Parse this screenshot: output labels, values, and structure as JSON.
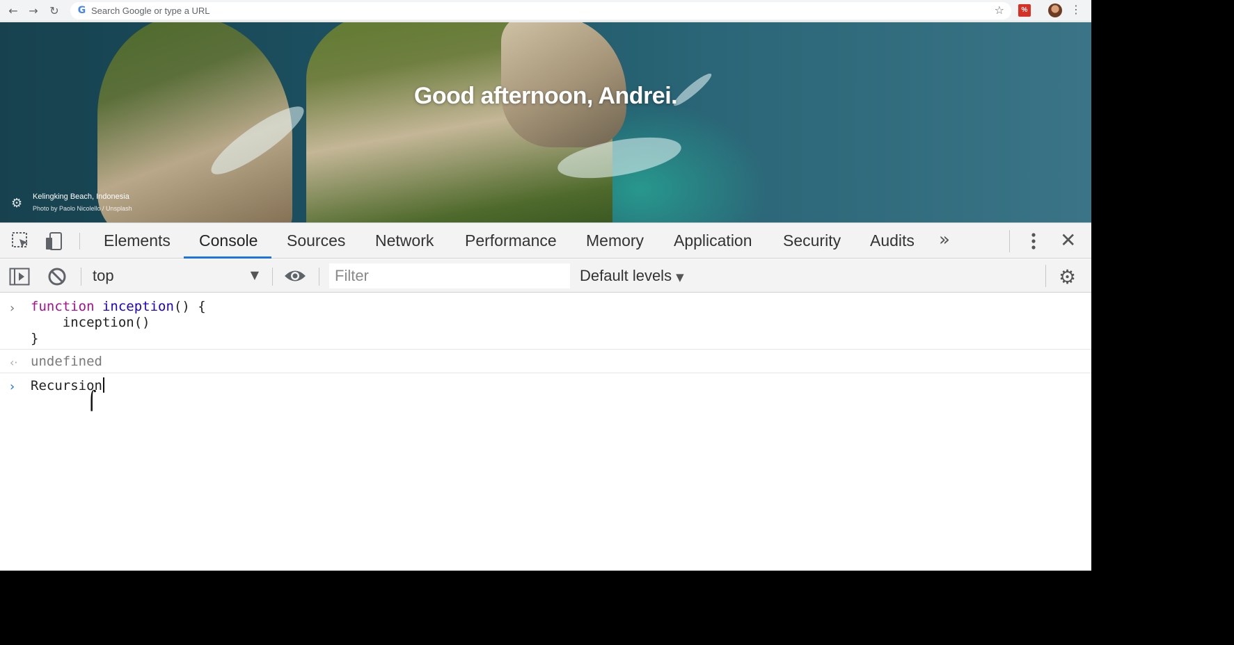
{
  "browser": {
    "back_icon": "back-arrow-icon",
    "forward_icon": "forward-arrow-icon",
    "reload_icon": "reload-icon",
    "omnibox_placeholder": "Search Google or type a URL",
    "bookmark_icon": "star-icon",
    "extension_icon": "extension-icon",
    "profile_icon": "avatar",
    "menu_icon": "kebab-menu-icon"
  },
  "newtab": {
    "greeting": "Good afternoon, Andrei.",
    "photo_location": "Kelingking Beach, Indonesia",
    "photo_credit": "Photo by Paolo Nicolello / Unsplash",
    "settings_icon": "gear-icon"
  },
  "devtools": {
    "tabs": [
      {
        "label": "Elements"
      },
      {
        "label": "Console"
      },
      {
        "label": "Sources"
      },
      {
        "label": "Network"
      },
      {
        "label": "Performance"
      },
      {
        "label": "Memory"
      },
      {
        "label": "Application"
      },
      {
        "label": "Security"
      },
      {
        "label": "Audits"
      }
    ],
    "active_tab": "Console",
    "accent_color": "#1a73e8",
    "more_tabs_glyph": "»",
    "console": {
      "context": "top",
      "filter_placeholder": "Filter",
      "levels": "Default levels",
      "entries": [
        {
          "type": "input",
          "line1_kw": "function",
          "line1_name": "inception",
          "line1_rest": "() {",
          "line2": "    inception()",
          "line3": "}"
        },
        {
          "type": "result",
          "text": "undefined"
        }
      ],
      "current_input": "Recursion"
    }
  }
}
